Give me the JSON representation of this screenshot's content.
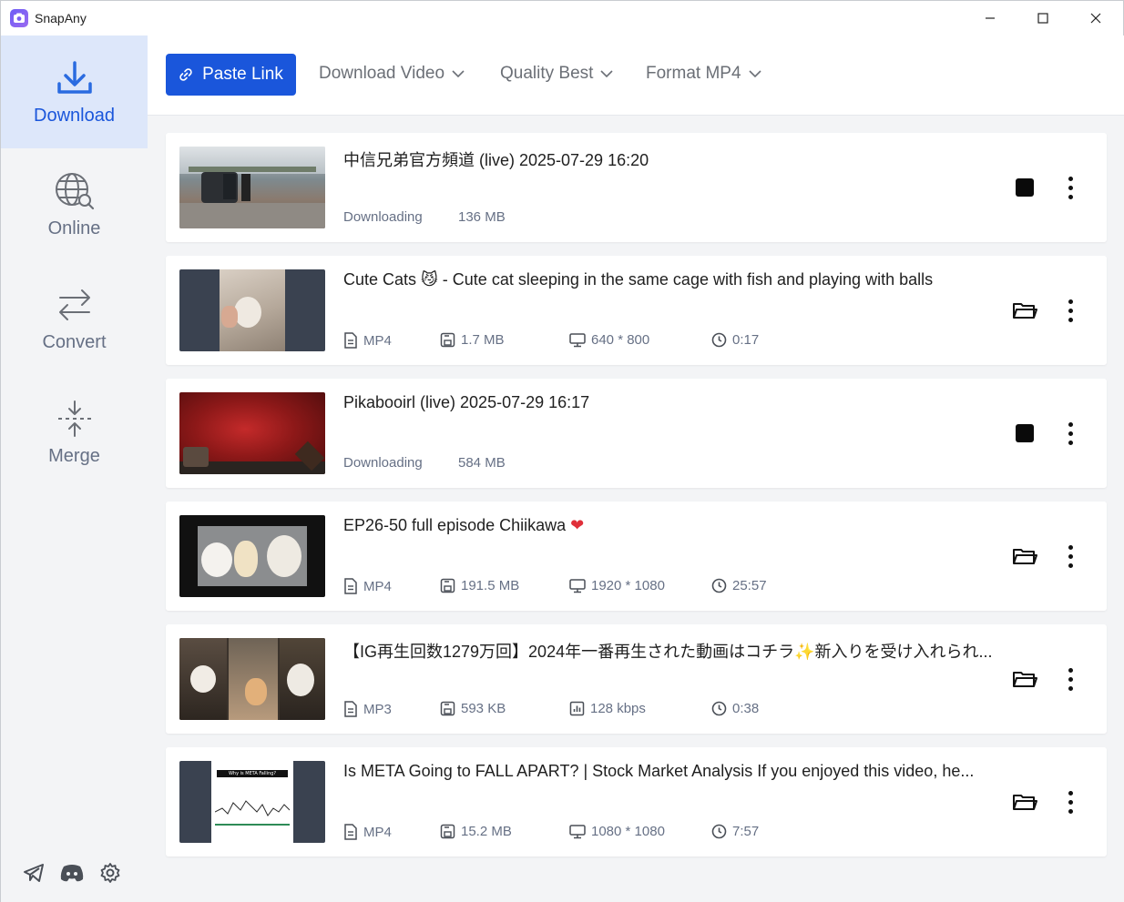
{
  "window": {
    "title": "SnapAny"
  },
  "sidebar": {
    "items": [
      {
        "label": "Download",
        "icon": "download-icon"
      },
      {
        "label": "Online",
        "icon": "globe-search-icon"
      },
      {
        "label": "Convert",
        "icon": "convert-arrows-icon"
      },
      {
        "label": "Merge",
        "icon": "merge-icon"
      }
    ],
    "footer_icons": [
      "telegram-icon",
      "discord-icon",
      "gear-icon"
    ]
  },
  "toolbar": {
    "paste_label": "Paste Link",
    "download_mode": "Download Video",
    "quality": "Quality Best",
    "format": "Format MP4"
  },
  "items": [
    {
      "title": "中信兄弟官方頻道 (live) 2025-07-29 16:20",
      "status": "Downloading",
      "size": "136 MB",
      "state": "downloading"
    },
    {
      "title": "Cute Cats 😼 - Cute cat sleeping in the same cage with fish and playing with balls",
      "format": "MP4",
      "size": "1.7 MB",
      "resolution": "640 * 800",
      "duration": "0:17",
      "state": "done"
    },
    {
      "title": "Pikabooirl (live) 2025-07-29 16:17",
      "status": "Downloading",
      "size": "584 MB",
      "state": "downloading"
    },
    {
      "title": "EP26-50 full episode Chiikawa",
      "title_emoji": "❤",
      "format": "MP4",
      "size": "191.5 MB",
      "resolution": "1920 * 1080",
      "duration": "25:57",
      "state": "done"
    },
    {
      "title": "【IG再生回数1279万回】2024年一番再生された動画はコチラ✨新入りを受け入れられ...",
      "format": "MP3",
      "size": "593 KB",
      "bitrate": "128 kbps",
      "duration": "0:38",
      "state": "done"
    },
    {
      "title": "Is META Going to FALL APART? | Stock Market Analysis If you enjoyed this video, he...",
      "format": "MP4",
      "size": "15.2 MB",
      "resolution": "1080 * 1080",
      "duration": "7:57",
      "thumb_text": "Why is META Falling?",
      "state": "done"
    }
  ],
  "colors": {
    "accent": "#1a56db",
    "sidebar_bg": "#f3f4f6",
    "active_bg": "#dde7fa",
    "muted_text": "#667085"
  }
}
